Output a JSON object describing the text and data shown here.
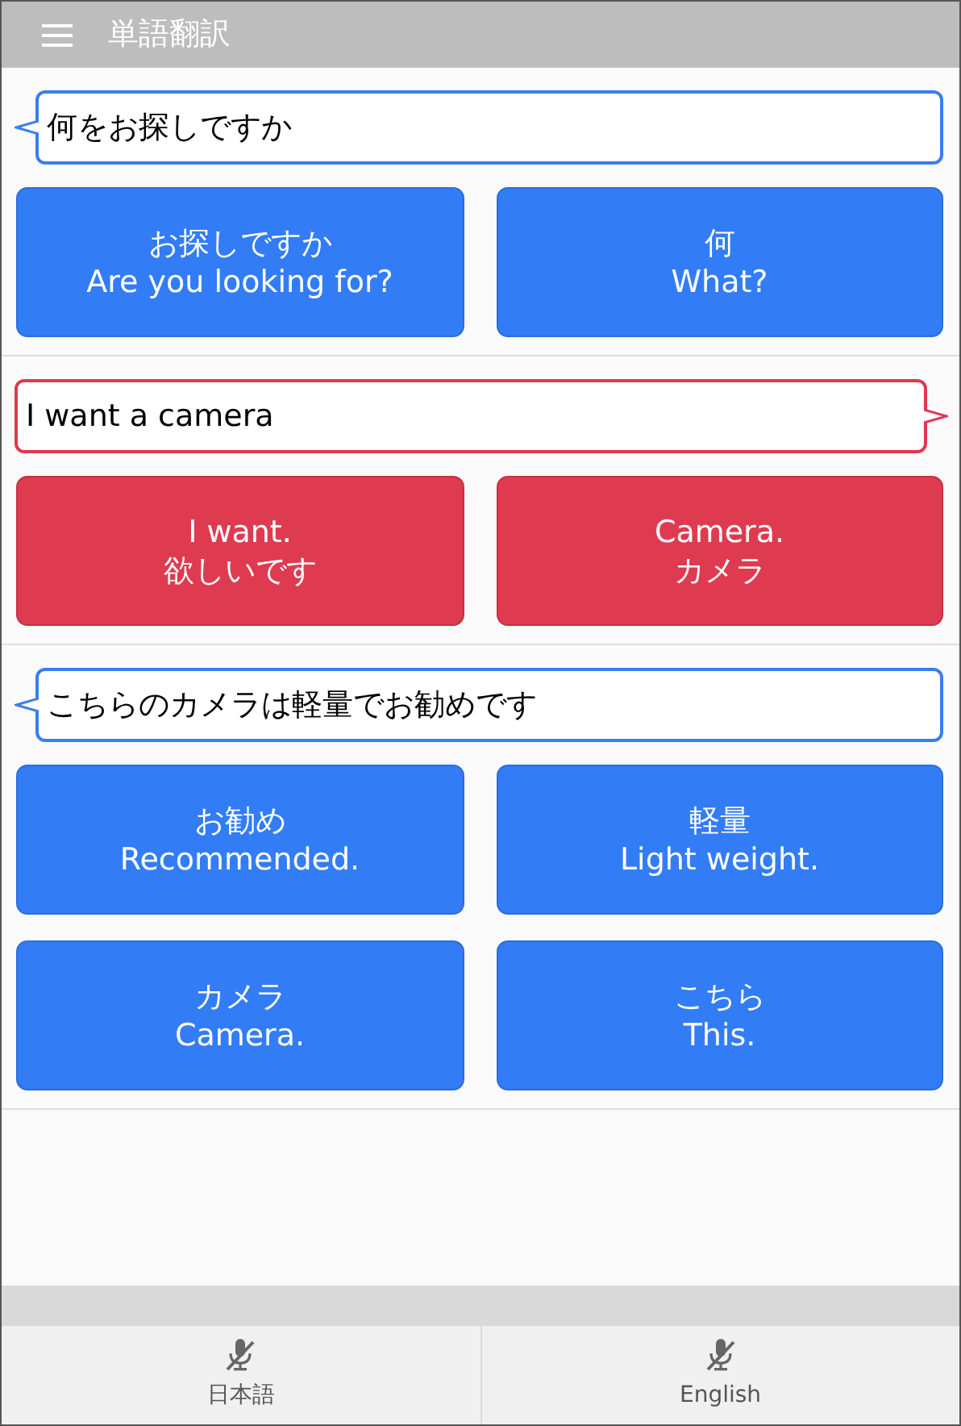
{
  "app_bar": {
    "title": "単語翻訳"
  },
  "conversation": [
    {
      "kind": "ja",
      "sentence": "何をお探しですか",
      "words": [
        {
          "source": "お探しですか",
          "translation": "Are you looking for?"
        },
        {
          "source": "何",
          "translation": "What?"
        }
      ]
    },
    {
      "kind": "en",
      "sentence": "I want a camera",
      "words": [
        {
          "source": "I want.",
          "translation": "欲しいです"
        },
        {
          "source": "Camera.",
          "translation": "カメラ"
        }
      ]
    },
    {
      "kind": "ja",
      "sentence": "こちらのカメラは軽量でお勧めです",
      "words": [
        {
          "source": "お勧め",
          "translation": "Recommended."
        },
        {
          "source": "軽量",
          "translation": "Light weight."
        },
        {
          "source": "カメラ",
          "translation": "Camera."
        },
        {
          "source": "こちら",
          "translation": "This."
        }
      ]
    }
  ],
  "mic_buttons": [
    {
      "label": "日本語",
      "muted": true
    },
    {
      "label": "English",
      "muted": true
    }
  ]
}
